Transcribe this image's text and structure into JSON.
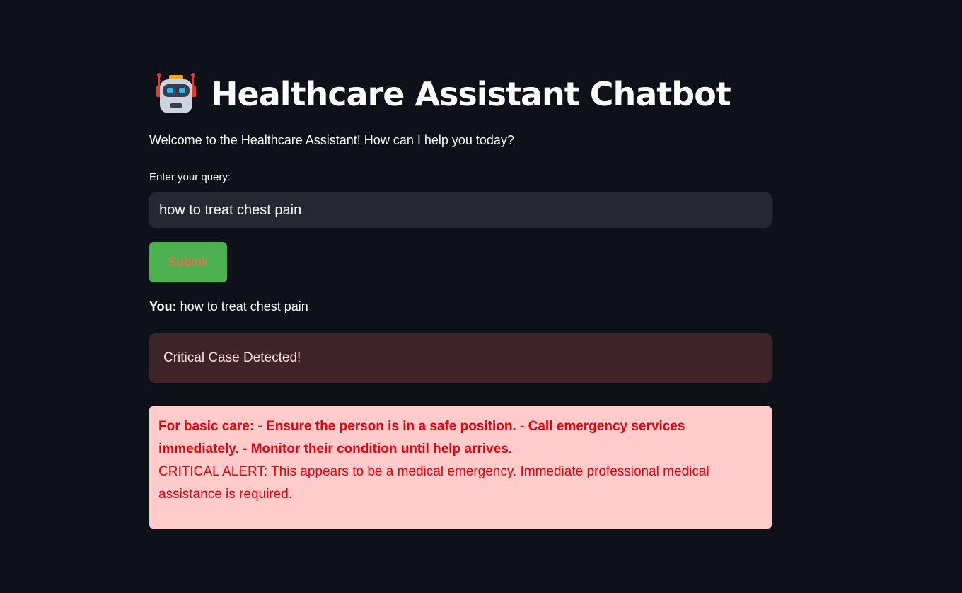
{
  "header": {
    "icon": "robot-icon",
    "title": "Healthcare Assistant Chatbot"
  },
  "welcome_text": "Welcome to the Healthcare Assistant! How can I help you today?",
  "query": {
    "label": "Enter your query:",
    "value": "how to treat chest pain"
  },
  "submit": {
    "label": "Submit"
  },
  "conversation": {
    "user_prefix": "You:",
    "user_message": "how to treat chest pain"
  },
  "critical_notice": {
    "text": "Critical Case Detected!"
  },
  "alert": {
    "basic_care": "For basic care: - Ensure the person is in a safe position. - Call emergency services immediately. - Monitor their condition until help arrives.",
    "critical_alert": "CRITICAL ALERT: This appears to be a medical emergency. Immediate professional medical assistance is required."
  },
  "colors": {
    "background": "#0e1117",
    "input_background": "#262730",
    "submit_button": "#4caf50",
    "submit_text": "#ff6b4a",
    "error_box": "#3e2329",
    "alert_box": "#ffcccb",
    "alert_text": "#e8000b"
  }
}
